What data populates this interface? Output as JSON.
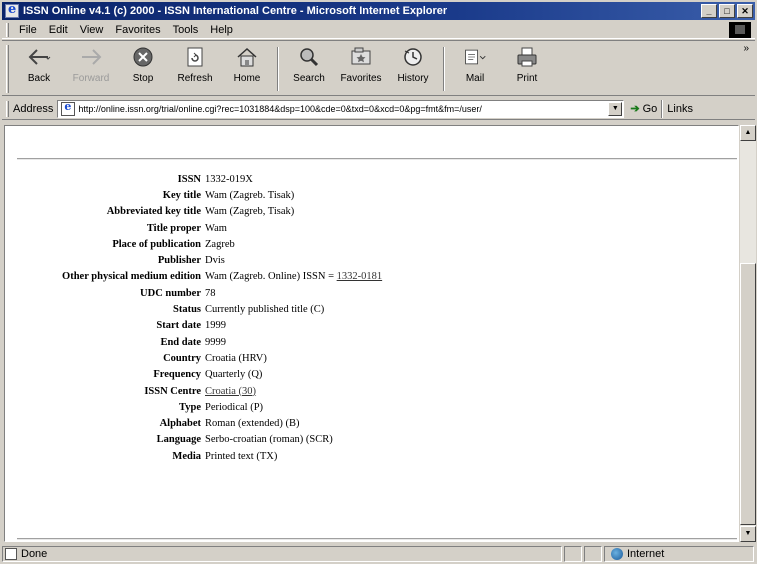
{
  "window": {
    "title": "ISSN Online v4.1 (c) 2000 - ISSN International Centre - Microsoft Internet Explorer",
    "buttons": [
      "_",
      "□",
      "✕"
    ]
  },
  "menubar": {
    "items": [
      {
        "label": "File"
      },
      {
        "label": "Edit"
      },
      {
        "label": "View"
      },
      {
        "label": "Favorites"
      },
      {
        "label": "Tools"
      },
      {
        "label": "Help"
      }
    ]
  },
  "toolbar": {
    "buttons": [
      {
        "label": "Back",
        "icon": "back-arrow-icon"
      },
      {
        "label": "Forward",
        "icon": "forward-arrow-icon"
      },
      {
        "label": "Stop",
        "icon": "stop-icon"
      },
      {
        "label": "Refresh",
        "icon": "refresh-icon"
      },
      {
        "label": "Home",
        "icon": "home-icon"
      },
      {
        "label": "Search",
        "icon": "search-icon"
      },
      {
        "label": "Favorites",
        "icon": "favorites-icon"
      },
      {
        "label": "History",
        "icon": "history-icon"
      },
      {
        "label": "Mail",
        "icon": "mail-icon"
      },
      {
        "label": "Print",
        "icon": "print-icon"
      }
    ]
  },
  "addressbar": {
    "label": "Address",
    "url": "http://online.issn.org/trial/online.cgi?rec=1031884&dsp=100&cde=0&txd=0&xcd=0&pg=fmt&fm=/user/",
    "go_label": "Go",
    "links_label": "Links"
  },
  "record": {
    "fields": [
      {
        "label": "ISSN",
        "value": "1332-019X"
      },
      {
        "label": "Key title",
        "value": "Wam (Zagreb. Tisak)"
      },
      {
        "label": "Abbreviated key title",
        "value": "Wam (Zagreb, Tisak)"
      },
      {
        "label": "Title proper",
        "value": "Wam"
      },
      {
        "label": "Place of publication",
        "value": "Zagreb"
      },
      {
        "label": "Publisher",
        "value": "Dvis"
      },
      {
        "label": "Other physical medium edition",
        "value": "Wam (Zagreb. Online) ISSN = ",
        "link": "1332-0181"
      },
      {
        "label": "UDC number",
        "value": "78"
      },
      {
        "label": "Status",
        "value": "Currently published title (C)"
      },
      {
        "label": "Start date",
        "value": "1999"
      },
      {
        "label": "End date",
        "value": "9999"
      },
      {
        "label": "Country",
        "value": "Croatia (HRV)"
      },
      {
        "label": "Frequency",
        "value": "Quarterly (Q)"
      },
      {
        "label": "ISSN Centre",
        "value": "",
        "link": "Croatia (30)"
      },
      {
        "label": "Type",
        "value": "Periodical (P)"
      },
      {
        "label": "Alphabet",
        "value": "Roman (extended) (B)"
      },
      {
        "label": "Language",
        "value": "Serbo-croatian (roman) (SCR)"
      },
      {
        "label": "Media",
        "value": "Printed text (TX)"
      }
    ]
  },
  "statusbar": {
    "status": "Done",
    "zone": "Internet"
  }
}
